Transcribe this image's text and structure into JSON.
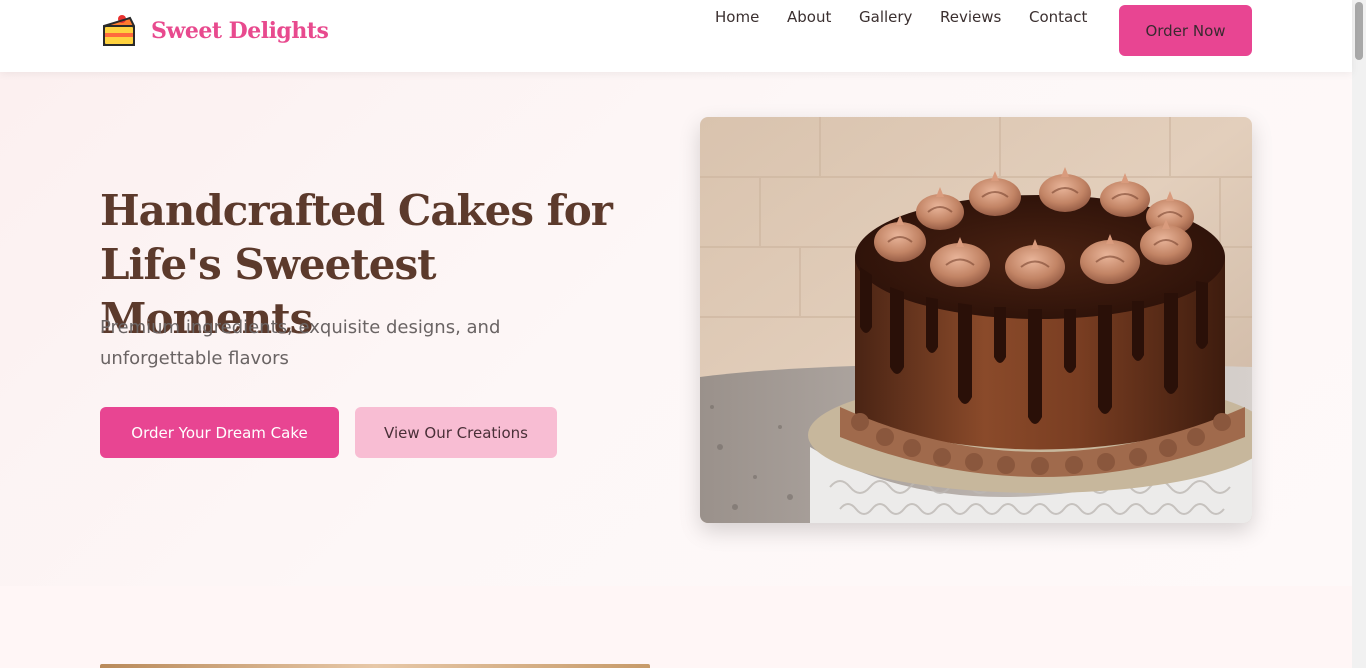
{
  "brand": {
    "name": "Sweet Delights",
    "logo_icon": "cake-slice-icon"
  },
  "nav": {
    "items": [
      {
        "label": "Home"
      },
      {
        "label": "About"
      },
      {
        "label": "Gallery"
      },
      {
        "label": "Reviews"
      },
      {
        "label": "Contact"
      }
    ],
    "cta_label": "Order Now"
  },
  "hero": {
    "title_line1": "Handcrafted Cakes for",
    "title_line2": "Life's Sweetest Moments",
    "subtitle": "Premium ingredients, exquisite designs, and unforgettable flavors",
    "primary_button": "Order Your Dream Cake",
    "secondary_button": "View Our Creations",
    "image_icon": "chocolate-drip-cake-photo"
  },
  "colors": {
    "accent": "#e84592",
    "accent_light": "#f8bdd3",
    "heading": "#5c3a2c",
    "text_muted": "#6a6464",
    "background": "#fdf6f6"
  }
}
